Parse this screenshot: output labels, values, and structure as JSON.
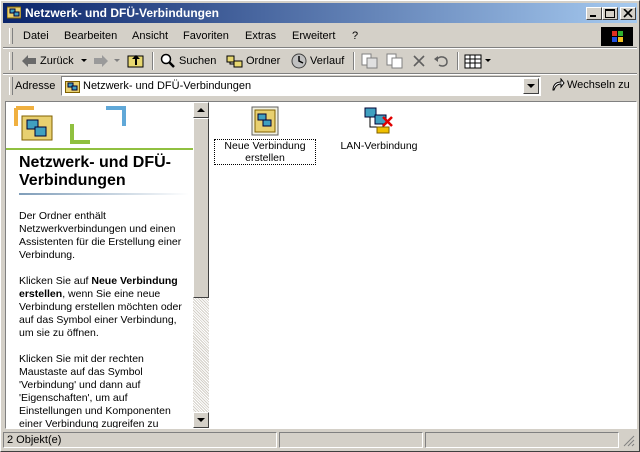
{
  "window": {
    "title": "Netzwerk- und DFÜ-Verbindungen"
  },
  "menu": {
    "items": [
      "Datei",
      "Bearbeiten",
      "Ansicht",
      "Favoriten",
      "Extras",
      "Erweitert",
      "?"
    ]
  },
  "toolbar": {
    "back_label": "Zurück",
    "search_label": "Suchen",
    "folders_label": "Ordner",
    "history_label": "Verlauf"
  },
  "address": {
    "label": "Adresse",
    "value": "Netzwerk- und DFÜ-Verbindungen",
    "go_label": "Wechseln zu"
  },
  "pane": {
    "title": "Netzwerk- und DFÜ-Verbindungen",
    "p1": "Der Ordner enthält Netzwerkverbindungen und einen Assistenten für die Erstellung einer Verbindung.",
    "p2_pre": "Klicken Sie auf ",
    "p2_bold": "Neue Verbindung erstellen",
    "p2_post": ", wenn Sie eine neue Verbindung erstellen möchten oder auf das Symbol einer Verbindung, um sie zu öffnen.",
    "p3": "Klicken Sie mit der rechten Maustaste auf das Symbol 'Verbindung' und dann auf 'Eigenschaften', um auf Einstellungen und Komponenten einer Verbindung zugreifen zu"
  },
  "files": [
    {
      "label": "Neue Verbindung erstellen",
      "icon": "new-connection-icon"
    },
    {
      "label": "LAN-Verbindung",
      "icon": "lan-connection-disconnected-icon"
    }
  ],
  "status": {
    "text": "2 Objekt(e)"
  },
  "colors": {
    "titlebar_start": "#0a246a",
    "titlebar_end": "#a6caf0",
    "chrome": "#d4d0c8"
  }
}
